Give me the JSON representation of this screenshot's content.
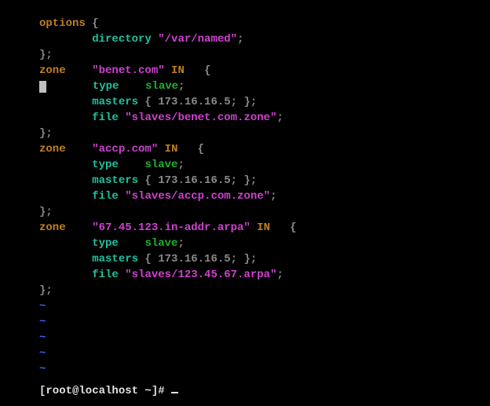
{
  "options": {
    "keyword": "options",
    "brace_open": "{",
    "directory_kw": "directory",
    "directory_val": "\"/var/named\"",
    "semi": ";",
    "close": "};"
  },
  "zones": [
    {
      "zone_kw": "zone",
      "name": "\"benet.com\"",
      "class": "IN",
      "brace": "{",
      "type_kw": "type",
      "type_val": "slave",
      "type_semi": ";",
      "masters_kw": "masters",
      "masters_val": "{ 173.16.16.5; };",
      "file_kw": "file",
      "file_val": "\"slaves/benet.com.zone\"",
      "file_semi": ";",
      "close": "};",
      "has_cursor": true
    },
    {
      "zone_kw": "zone",
      "name": "\"accp.com\"",
      "class": "IN",
      "brace": "{",
      "type_kw": "type",
      "type_val": "slave",
      "type_semi": ";",
      "masters_kw": "masters",
      "masters_val": "{ 173.16.16.5; };",
      "file_kw": "file",
      "file_val": "\"slaves/accp.com.zone\"",
      "file_semi": ";",
      "close": "};",
      "has_cursor": false
    },
    {
      "zone_kw": "zone",
      "name": "\"67.45.123.in-addr.arpa\"",
      "class": "IN",
      "brace": "{",
      "type_kw": "type",
      "type_val": "slave",
      "type_semi": ";",
      "masters_kw": "masters",
      "masters_val": "{ 173.16.16.5; };",
      "file_kw": "file",
      "file_val": "\"slaves/123.45.67.arpa\"",
      "file_semi": ";",
      "close": "};",
      "has_cursor": false
    }
  ],
  "tilde": "~",
  "prompt": "[root@localhost ~]# "
}
